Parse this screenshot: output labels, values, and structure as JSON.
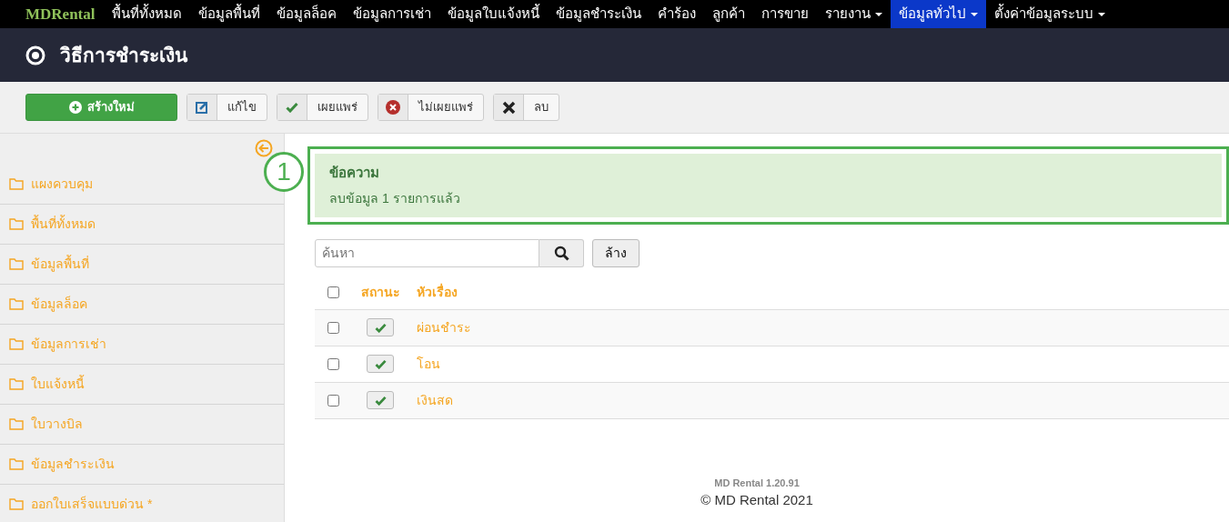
{
  "navbar": {
    "brand": "MDRental",
    "items": [
      {
        "label": "พื้นที่ทั้งหมด",
        "dropdown": false,
        "selected": false
      },
      {
        "label": "ข้อมูลพื้นที่",
        "dropdown": false,
        "selected": false
      },
      {
        "label": "ข้อมูลล็อค",
        "dropdown": false,
        "selected": false
      },
      {
        "label": "ข้อมูลการเช่า",
        "dropdown": false,
        "selected": false
      },
      {
        "label": "ข้อมูลใบแจ้งหนี้",
        "dropdown": false,
        "selected": false
      },
      {
        "label": "ข้อมูลชำระเงิน",
        "dropdown": false,
        "selected": false
      },
      {
        "label": "คำร้อง",
        "dropdown": false,
        "selected": false
      },
      {
        "label": "ลูกค้า",
        "dropdown": false,
        "selected": false
      },
      {
        "label": "การขาย",
        "dropdown": false,
        "selected": false
      },
      {
        "label": "รายงาน",
        "dropdown": true,
        "selected": false
      },
      {
        "label": "ข้อมูลทั่วไป",
        "dropdown": true,
        "selected": true
      },
      {
        "label": "ตั้งค่าข้อมูลระบบ",
        "dropdown": true,
        "selected": false
      }
    ]
  },
  "page_title": "วิธีการชำระเงิน",
  "toolbar": [
    {
      "kind": "new",
      "label": "สร้างใหม่"
    },
    {
      "kind": "edit",
      "label": "แก้ไข"
    },
    {
      "kind": "publish",
      "label": "เผยแพร่"
    },
    {
      "kind": "unpublish",
      "label": "ไม่เผยแพร่"
    },
    {
      "kind": "delete",
      "label": "ลบ"
    }
  ],
  "sidebar": {
    "items": [
      {
        "label": "แผงควบคุม"
      },
      {
        "label": "พื้นที่ทั้งหมด"
      },
      {
        "label": "ข้อมูลพื้นที่"
      },
      {
        "label": "ข้อมูลล็อค"
      },
      {
        "label": "ข้อมูลการเช่า"
      },
      {
        "label": "ใบแจ้งหนี้"
      },
      {
        "label": "ใบวางบิล"
      },
      {
        "label": "ข้อมูลชำระเงิน"
      },
      {
        "label": "ออกใบเสร็จแบบด่วน *"
      }
    ]
  },
  "annotation": {
    "number": "1"
  },
  "message": {
    "title": "ข้อความ",
    "text": "ลบข้อมูล 1 รายการแล้ว"
  },
  "search": {
    "placeholder": "ค้นหา",
    "clear_label": "ล้าง"
  },
  "table": {
    "columns": [
      "สถานะ",
      "หัวเรื่อง"
    ],
    "select_all_checked": false,
    "rows": [
      {
        "title": "ผ่อนชำระ",
        "published": true,
        "checked": false
      },
      {
        "title": "โอน",
        "published": true,
        "checked": false
      },
      {
        "title": "เงินสด",
        "published": true,
        "checked": false
      }
    ]
  },
  "footer": {
    "version": "MD Rental 1.20.91",
    "copyright": "© MD Rental 2021"
  }
}
